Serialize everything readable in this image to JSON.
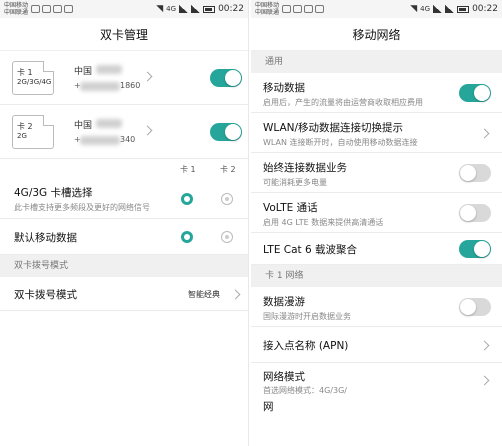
{
  "left": {
    "status": {
      "carrier_top": "中国移动",
      "carrier_bottom": "中国联通",
      "net": "4G",
      "time": "00:22"
    },
    "title": "双卡管理",
    "sims": [
      {
        "name": "卡 1",
        "network": "2G/3G/4G",
        "carrier": "中国",
        "number_suffix": "1860",
        "enabled": true
      },
      {
        "name": "卡 2",
        "network": "2G",
        "carrier": "中国",
        "number_suffix": "340",
        "enabled": true
      }
    ],
    "columns": {
      "card1": "卡 1",
      "card2": "卡 2"
    },
    "slot_select": {
      "label": "4G/3G 卡槽选择",
      "desc": "此卡槽支持更多频段及更好的网络信号",
      "selected": "卡 1"
    },
    "default_data": {
      "label": "默认移动数据",
      "selected": "卡 1"
    },
    "dial_section": "双卡拨号模式",
    "dial_mode": {
      "label": "双卡拨号模式",
      "value": "智能经典"
    }
  },
  "right": {
    "status": {
      "carrier_top": "中国移动",
      "carrier_bottom": "中国联通",
      "net": "4G",
      "time": "00:22"
    },
    "title": "移动网络",
    "section_general": "通用",
    "items": [
      {
        "label": "移动数据",
        "desc": "启用后，产生的流量将由运营商收取相应费用",
        "control": "toggle",
        "on": true
      },
      {
        "label": "WLAN/移动数据连接切换提示",
        "desc": "WLAN 连接断开时，自动使用移动数据连接",
        "control": "chevron"
      },
      {
        "label": "始终连接数据业务",
        "desc": "可能消耗更多电量",
        "control": "toggle",
        "on": false
      },
      {
        "label": "VoLTE 通话",
        "desc": "启用 4G LTE 数据来提供高清通话",
        "control": "toggle",
        "on": false
      },
      {
        "label": "LTE Cat 6 载波聚合",
        "desc": "",
        "control": "toggle",
        "on": true
      }
    ],
    "section_card1": "卡 1 网络",
    "card1_items": [
      {
        "label": "数据漫游",
        "desc": "国际漫游时开启数据业务",
        "control": "toggle",
        "on": false
      },
      {
        "label": "接入点名称 (APN)",
        "desc": "",
        "control": "chevron"
      },
      {
        "label": "网络模式",
        "desc": "首选网络模式：4G/3G/",
        "control": "chevron"
      },
      {
        "label": "网",
        "desc": "",
        "control": "none"
      }
    ]
  },
  "colors": {
    "accent": "#26a69a",
    "section_bg": "#f0f0f0",
    "toggle_off": "#d9d9d9"
  }
}
